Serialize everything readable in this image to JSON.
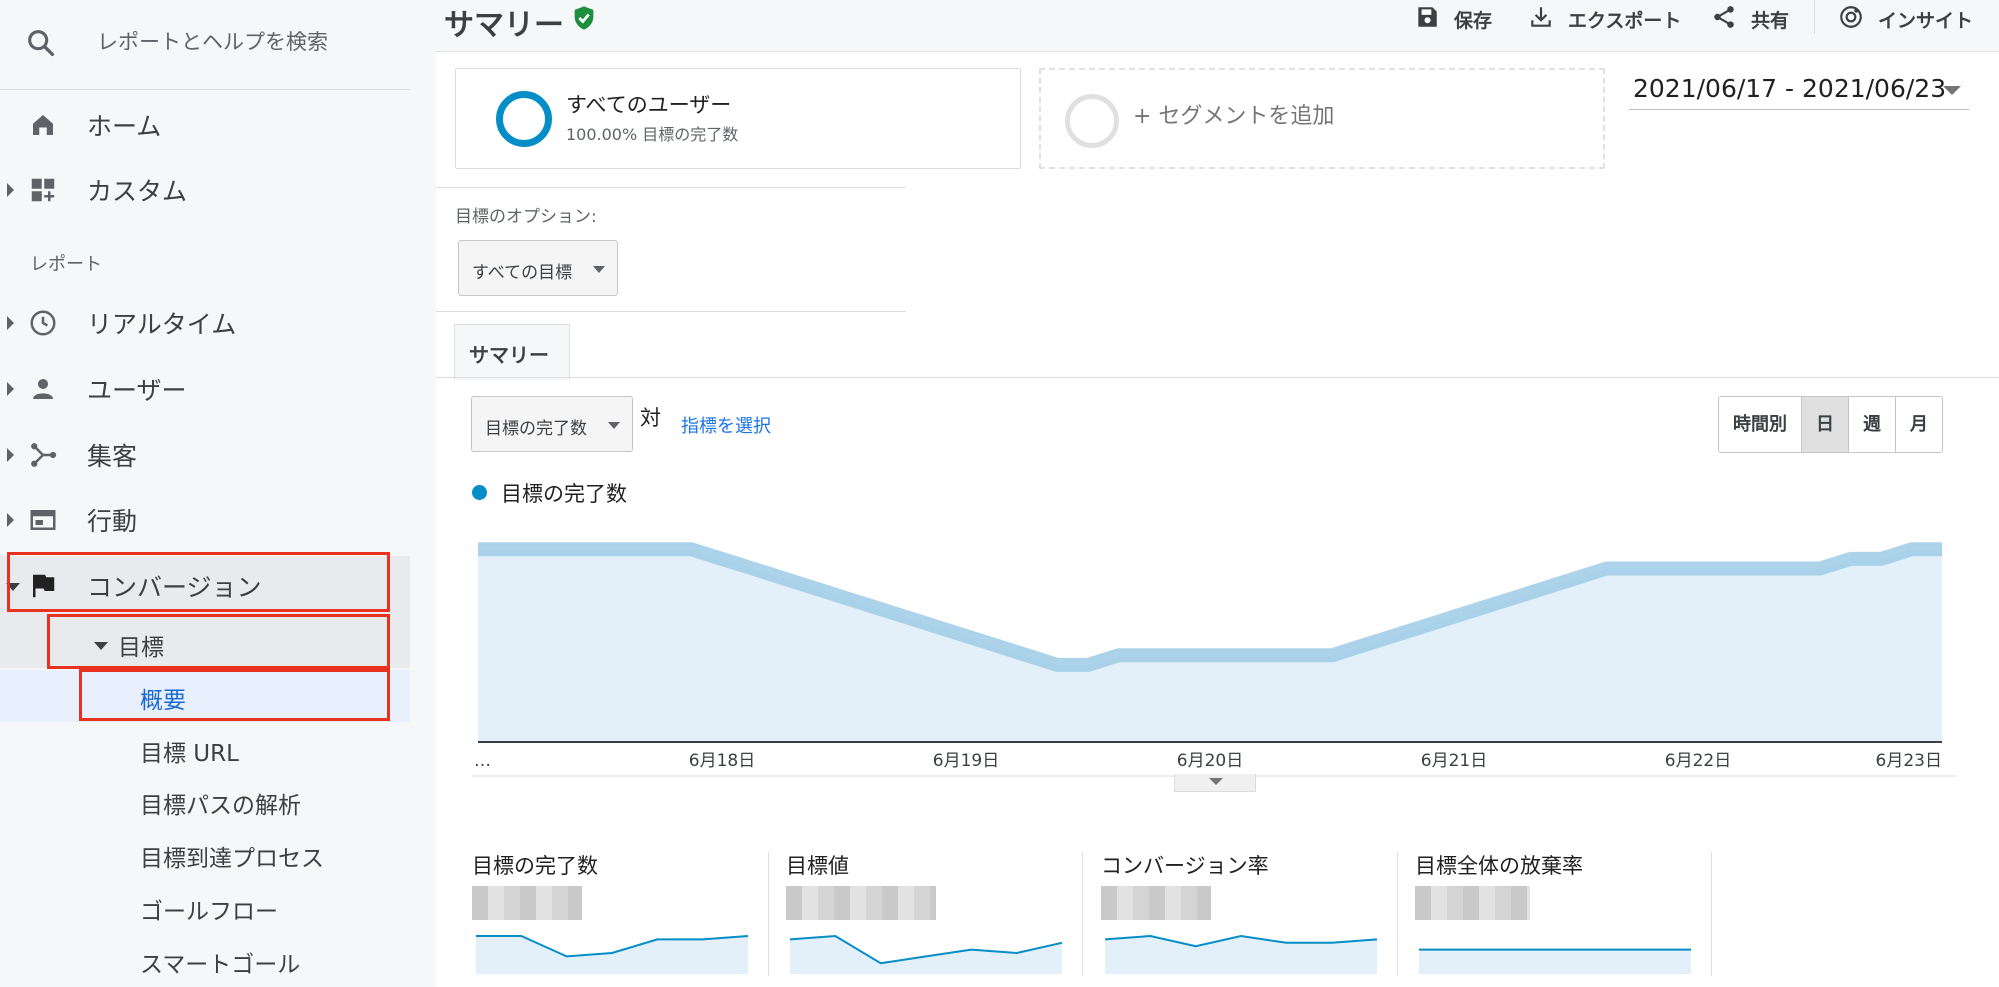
{
  "sidebar": {
    "search_placeholder": "レポートとヘルプを検索",
    "home": "ホーム",
    "custom": "カスタム",
    "section_reports": "レポート",
    "realtime": "リアルタイム",
    "users": "ユーザー",
    "acquisition": "集客",
    "behavior": "行動",
    "conversions": "コンバージョン",
    "goals": "目標",
    "sub_items": [
      "概要",
      "目標 URL",
      "目標パスの解析",
      "目標到達プロセス",
      "ゴールフロー",
      "スマートゴール"
    ]
  },
  "header": {
    "title": "サマリー",
    "save": "保存",
    "export": "エクスポート",
    "share": "共有",
    "insights": "インサイト"
  },
  "segments": {
    "all_users_name": "すべてのユーザー",
    "all_users_sub": "100.00% 目標の完了数",
    "add_segment": "+ セグメントを追加"
  },
  "date_range": "2021/06/17 - 2021/06/23",
  "options": {
    "label": "目標のオプション:",
    "selected": "すべての目標"
  },
  "tabs": [
    "サマリー"
  ],
  "metric_controls": {
    "metric": "目標の完了数",
    "vs": "対",
    "pick_metric": "指標を選択",
    "granularity": [
      "時間別",
      "日",
      "週",
      "月"
    ],
    "granularity_selected": "日"
  },
  "colors": {
    "series": "#058dc7",
    "highlight": "#e8321f",
    "link": "#1a73e8"
  },
  "chart_data": {
    "type": "area",
    "series": [
      {
        "name": "目標の完了数"
      }
    ],
    "x_labels": [
      "…",
      "6月18日",
      "6月19日",
      "6月20日",
      "6月21日",
      "6月22日",
      "6月23日"
    ],
    "x": [
      0,
      3,
      6,
      9,
      12,
      15,
      18,
      21,
      24,
      27,
      30,
      33,
      36,
      39,
      42,
      45,
      48,
      51,
      54,
      57,
      60,
      63,
      66,
      69,
      72,
      75,
      78,
      81,
      84,
      87,
      90,
      93,
      96,
      99,
      102,
      105,
      108,
      111,
      114,
      117,
      120,
      123,
      126,
      129,
      132,
      135,
      138,
      141,
      144
    ],
    "values": [
      10,
      10,
      10,
      10,
      10,
      10,
      10,
      10,
      9.5,
      9,
      8.5,
      8,
      7.5,
      7,
      6.5,
      6,
      5.5,
      5,
      4.5,
      4,
      4,
      4.5,
      4.5,
      4.5,
      4.5,
      4.5,
      4.5,
      4.5,
      4.5,
      5,
      5.5,
      6,
      6.5,
      7,
      7.5,
      8,
      8.5,
      9,
      9,
      9,
      9,
      9,
      9,
      9,
      9,
      9.5,
      9.5,
      10,
      10
    ],
    "ylim": [
      0,
      11
    ],
    "grid": false
  },
  "scorecards": [
    {
      "label": "目標の完了数",
      "spark": [
        10,
        10,
        4,
        5,
        9,
        9,
        10
      ]
    },
    {
      "label": "目標値",
      "spark": [
        9,
        10,
        2,
        4,
        6,
        5,
        8
      ]
    },
    {
      "label": "コンバージョン率",
      "spark": [
        9,
        10,
        7,
        10,
        8,
        8,
        9
      ]
    },
    {
      "label": "目標全体の放棄率",
      "spark": [
        6,
        6,
        6,
        6,
        6,
        6,
        6
      ]
    }
  ]
}
